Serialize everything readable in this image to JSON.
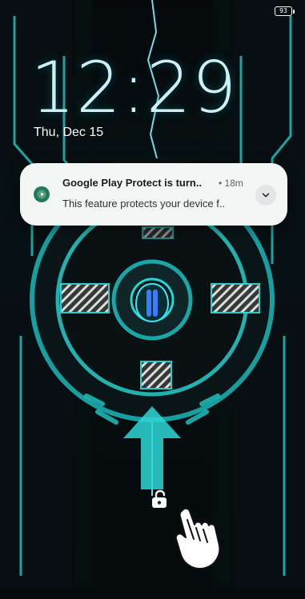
{
  "status_bar": {
    "battery_level": "93"
  },
  "lock_screen": {
    "time": "12:29",
    "date": "Thu, Dec 15"
  },
  "notification": {
    "app_icon": "play-protect-icon",
    "title": "Google Play Protect is turn..",
    "time": "• 18m",
    "body": "This feature protects your device f..",
    "expand_icon": "chevron-down-icon"
  },
  "gesture": {
    "unlock_icon": "unlock-icon",
    "hand_icon": "pointing-hand-icon"
  },
  "colors": {
    "accent": "#24d6d4",
    "notification_bg": "#f4f6f6",
    "icon_green": "#1f7a55"
  }
}
